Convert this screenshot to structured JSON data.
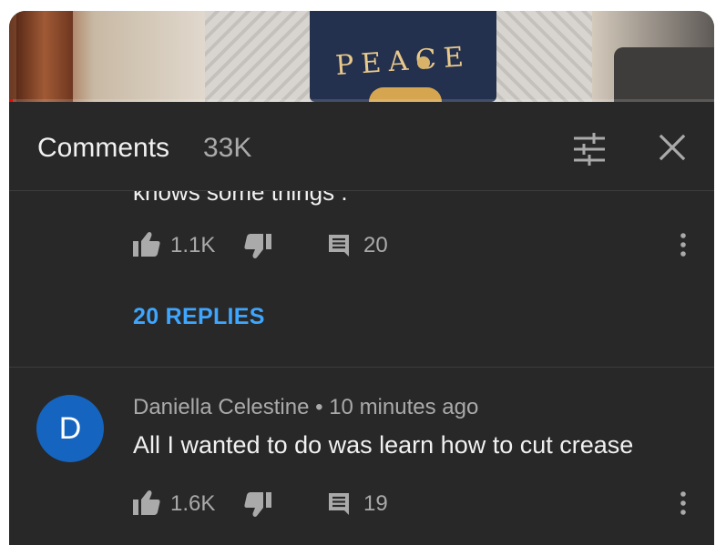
{
  "header": {
    "title": "Comments",
    "count": "33K"
  },
  "comments": [
    {
      "truncated_text": "knows some things .",
      "likes": "1.1K",
      "replies_count": "20",
      "replies_link": "20 REPLIES"
    },
    {
      "avatar_letter": "D",
      "author": "Daniella Celestine",
      "separator": "•",
      "time": "10 minutes ago",
      "text": "All I wanted to do was learn how to cut crease",
      "likes": "1.6K",
      "replies_count": "19"
    }
  ],
  "video": {
    "shirt_text": "PEACE"
  },
  "colors": {
    "background": "#282828",
    "text_primary": "#f1f1f1",
    "text_secondary": "#aaaaaa",
    "link": "#3ea6ff",
    "avatar": "#1565c0"
  },
  "icons": [
    "filter-icon",
    "close-icon",
    "thumbs-up-icon",
    "thumbs-down-icon",
    "reply-icon",
    "more-vert-icon"
  ]
}
